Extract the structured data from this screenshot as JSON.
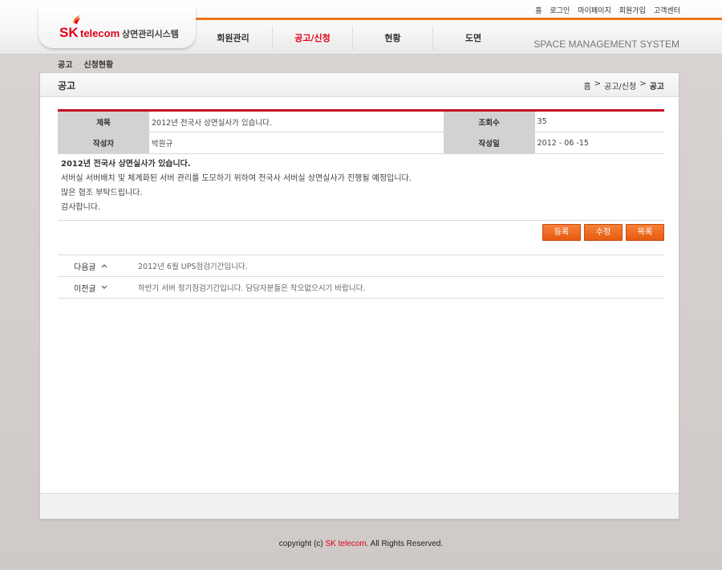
{
  "header": {
    "logo_sk": "SK",
    "logo_telecom": "telecom",
    "logo_system": "상면관리시스템",
    "util_links": [
      "홈",
      "로그인",
      "마이페이지",
      "회원가입",
      "고객센터"
    ],
    "gnb": [
      {
        "label": "회원관리",
        "active": false
      },
      {
        "label": "공고/신청",
        "active": true
      },
      {
        "label": "현황",
        "active": false
      },
      {
        "label": "도면",
        "active": false
      }
    ],
    "system_title": "SPACE MANAGEMENT SYSTEM"
  },
  "subnav": [
    "공고",
    "신청현황"
  ],
  "panel": {
    "title": "공고",
    "breadcrumb": [
      "홈",
      ">",
      "공고/신청",
      ">",
      "공고"
    ]
  },
  "post": {
    "title_label": "제목",
    "title": "2012년 전국사 상면실사가 있습니다.",
    "views_label": "조회수",
    "views": "35",
    "author_label": "작성자",
    "author": "박원규",
    "date_label": "작성일",
    "date": "2012 - 06 -15",
    "body": [
      "2012년 전국사 상면실사가 있습니다.",
      "서버실 서버배치 및 체계화된 서버 관리를 도모하기 위하여 전국사 서버실 상면실사가 진행될 예정입니다.",
      "많은 협조 부탁드립니다.",
      "감사합니다."
    ]
  },
  "buttons": {
    "register": "등록",
    "edit": "수정",
    "list": "목록"
  },
  "adjacent": {
    "next_label": "다음글",
    "next_title": "2012년 6월 UPS점검기간입니다.",
    "prev_label": "이전글",
    "prev_title": "하반기 서버 정기점검기간입니다. 담당자분들은 착오없으시기 바랍니다."
  },
  "footer": {
    "prefix": "copyright (c) ",
    "brand": "SK telecom",
    "suffix": ". All Rights Reserved."
  },
  "colors": {
    "accent": "#f0741c",
    "brand_red": "#e2001a",
    "button": "#e65a10"
  }
}
